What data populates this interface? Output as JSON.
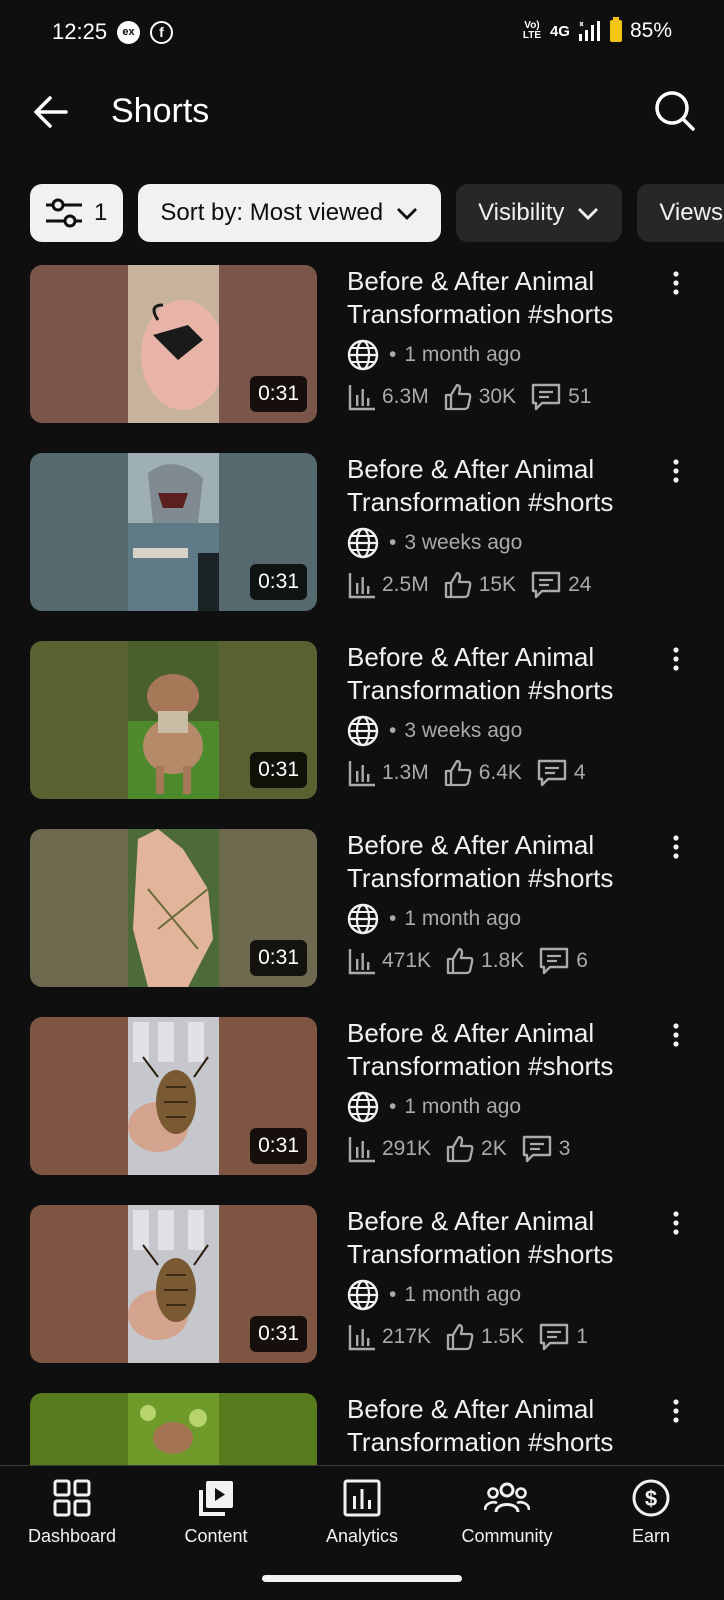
{
  "status_bar": {
    "time": "12:25",
    "network_badge": "Vo)\nLTE",
    "network": "4G",
    "battery": "85%",
    "notification_icons": [
      "ex-icon",
      "facebook-icon"
    ]
  },
  "header": {
    "title": "Shorts",
    "back_icon": "back-arrow-icon",
    "search_icon": "search-icon"
  },
  "filters": {
    "filter_count": "1",
    "sort_label": "Sort by: Most viewed",
    "visibility_label": "Visibility",
    "views_label": "Views"
  },
  "videos": [
    {
      "title": "Before & After Animal Transformation #shorts",
      "age": "1 month ago",
      "views": "6.3M",
      "likes": "30K",
      "comments": "51",
      "duration": "0:31",
      "bg": "#7a5549",
      "scene": "scorpion in palm"
    },
    {
      "title": "Before & After Animal Transformation #shorts",
      "age": "3 weeks ago",
      "views": "2.5M",
      "likes": "15K",
      "comments": "24",
      "duration": "0:31",
      "bg": "#55696e",
      "scene": "shark at sea"
    },
    {
      "title": "Before & After Animal Transformation #shorts",
      "age": "3 weeks ago",
      "views": "1.3M",
      "likes": "6.4K",
      "comments": "4",
      "duration": "0:31",
      "bg": "#5a6130",
      "scene": "dog on grass"
    },
    {
      "title": "Before & After Animal Transformation #shorts",
      "age": "1 month ago",
      "views": "471K",
      "likes": "1.8K",
      "comments": "6",
      "duration": "0:31",
      "bg": "#6e6a50",
      "scene": "stick insect on hand"
    },
    {
      "title": "Before & After Animal Transformation #shorts",
      "age": "1 month ago",
      "views": "291K",
      "likes": "2K",
      "comments": "3",
      "duration": "0:31",
      "bg": "#7d5542",
      "scene": "beetle in hand"
    },
    {
      "title": "Before & After Animal Transformation #shorts",
      "age": "1 month ago",
      "views": "217K",
      "likes": "1.5K",
      "comments": "1",
      "duration": "0:31",
      "bg": "#7d5542",
      "scene": "beetle in hand"
    },
    {
      "title": "Before & After Animal Transformation #shorts",
      "age": "",
      "views": "",
      "likes": "",
      "comments": "",
      "duration": "",
      "bg": "#567a1c",
      "scene": "small animal in grass"
    }
  ],
  "bottom_nav": [
    {
      "label": "Dashboard",
      "icon": "dashboard-icon"
    },
    {
      "label": "Content",
      "icon": "content-icon"
    },
    {
      "label": "Analytics",
      "icon": "analytics-icon"
    },
    {
      "label": "Community",
      "icon": "community-icon"
    },
    {
      "label": "Earn",
      "icon": "earn-icon"
    }
  ]
}
